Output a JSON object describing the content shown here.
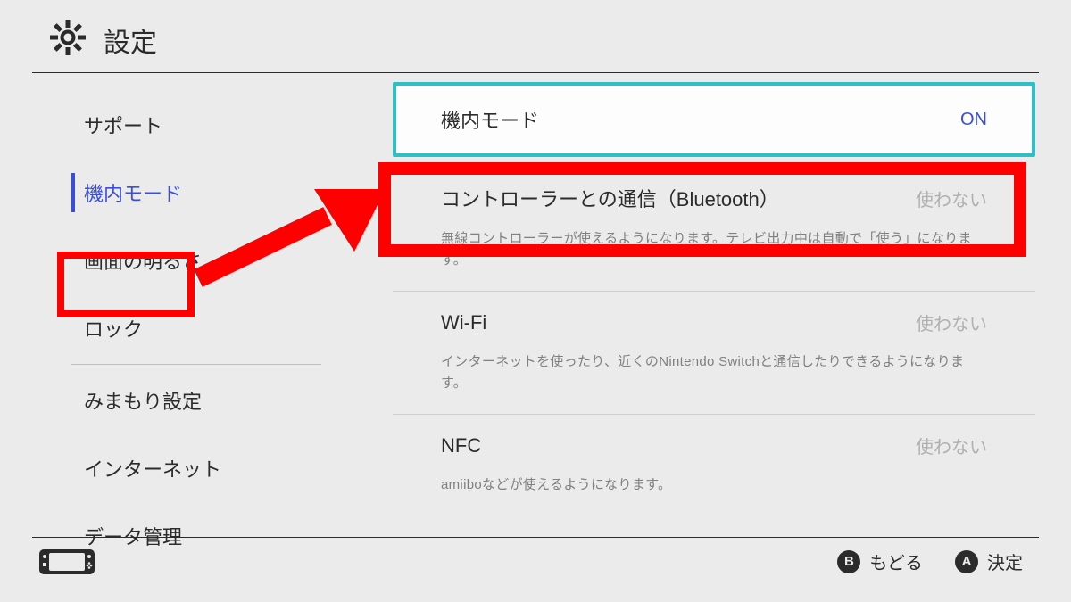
{
  "header": {
    "title": "設定"
  },
  "sidebar": {
    "items": [
      {
        "label": "サポート"
      },
      {
        "label": "機内モード"
      },
      {
        "label": "画面の明るさ"
      },
      {
        "label": "ロック"
      },
      {
        "label": "みまもり設定"
      },
      {
        "label": "インターネット"
      },
      {
        "label": "データ管理"
      }
    ]
  },
  "main": {
    "airplane": {
      "label": "機内モード",
      "value": "ON"
    },
    "bluetooth": {
      "label": "コントローラーとの通信（Bluetooth）",
      "value": "使わない",
      "desc": "無線コントローラーが使えるようになります。テレビ出力中は自動で「使う」になります。"
    },
    "wifi": {
      "label": "Wi-Fi",
      "value": "使わない",
      "desc": "インターネットを使ったり、近くのNintendo Switchと通信したりできるようになります。"
    },
    "nfc": {
      "label": "NFC",
      "value": "使わない",
      "desc": "amiiboなどが使えるようになります。"
    }
  },
  "footer": {
    "back": {
      "glyph": "B",
      "label": "もどる"
    },
    "ok": {
      "glyph": "A",
      "label": "決定"
    }
  }
}
